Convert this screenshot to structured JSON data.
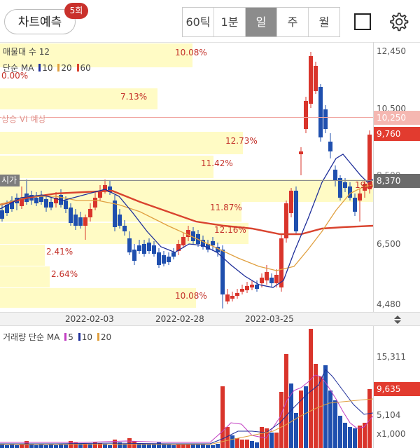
{
  "toolbar": {
    "predict_label": "차트예측",
    "predict_badge": "5회",
    "periods": [
      "60틱",
      "1분",
      "일",
      "주",
      "월"
    ],
    "active_period": "일"
  },
  "price_chart": {
    "volume_profile_legend": "매물대 수 12",
    "ma_legend": {
      "prefix": "단순 MA",
      "periods": [
        "10",
        "20",
        "60"
      ],
      "colors": [
        "#1f2f9a",
        "#e0a040",
        "#d9432e"
      ]
    },
    "volume_profile_pcts": [
      "10.08%",
      "0.00%",
      "7.13%",
      "12.73%",
      "11.42%",
      "19.4",
      "11.87%",
      "12.16%",
      "2.41%",
      "2.64%",
      "10.08%"
    ],
    "y_ticks": [
      "12,450",
      "10,500",
      "6,500",
      "4,480"
    ],
    "vi_label": "상승 VI 예상",
    "vi_price": "10,250",
    "last_price": "9,760",
    "start_label": "시가",
    "start_price": "8,370",
    "hidden_tick": "8,500",
    "dates": [
      "2022-02-03",
      "2022-02-28",
      "2022-03-25"
    ],
    "colors": {
      "up": "#d9342b",
      "down": "#1f4fae",
      "ma10": "#1f2f9a",
      "ma20": "#e0a040",
      "ma60": "#d9432e"
    }
  },
  "volume_chart": {
    "legend": {
      "prefix": "거래량 단순 MA",
      "periods": [
        "5",
        "10",
        "20"
      ],
      "colors": [
        "#c23fc2",
        "#1f2f9a",
        "#e0a040"
      ]
    },
    "y_ticks": [
      "15,311",
      "5,104",
      "x1,000"
    ],
    "last_volume": "9,635"
  }
}
